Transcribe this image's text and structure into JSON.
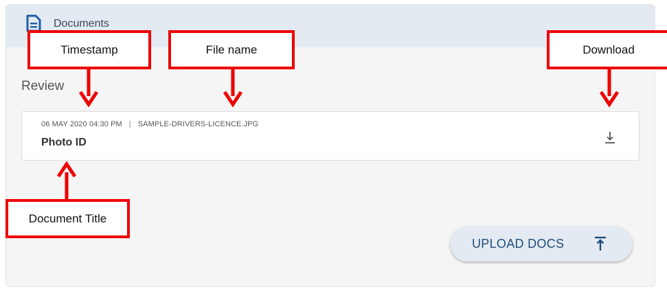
{
  "header": {
    "title": "Documents",
    "icon": "document-icon"
  },
  "section": {
    "label": "Review"
  },
  "document": {
    "timestamp": "06 MAY 2020 04:30 PM",
    "separator": "|",
    "file_name": "SAMPLE-DRIVERS-LICENCE.JPG",
    "title": "Photo ID",
    "download_icon": "download-icon"
  },
  "upload_button": {
    "label": "UPLOAD DOCS",
    "icon": "upload-icon"
  },
  "annotations": {
    "timestamp": "Timestamp",
    "file_name": "File name",
    "download": "Download",
    "document_title": "Document Title"
  },
  "colors": {
    "accent": "#1f4e79",
    "header_bg": "#e3eaf2",
    "annotation": "#ee0000"
  }
}
